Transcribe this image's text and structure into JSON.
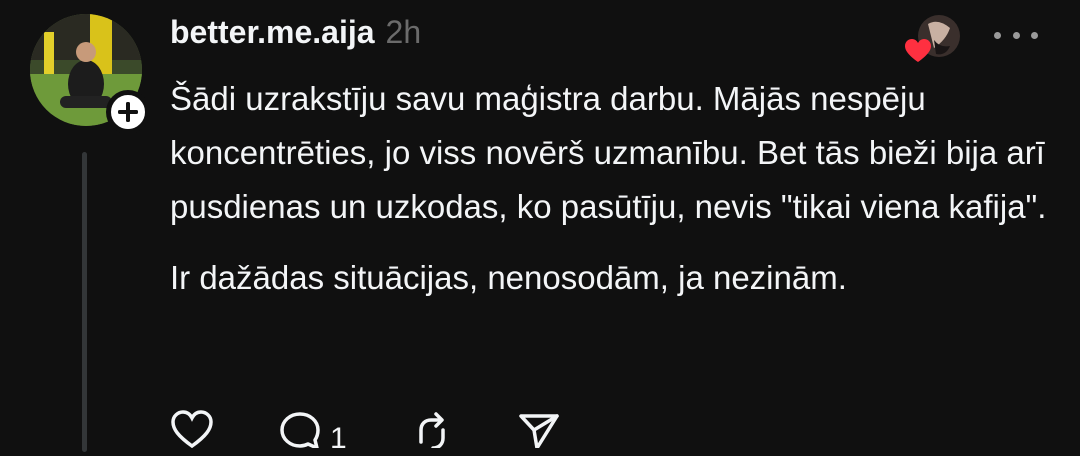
{
  "post": {
    "username": "better.me.aija",
    "time": "2h",
    "paragraphs": [
      "Šādi uzrakstīju savu maģistra darbu. Mājās nespēju koncentrēties, jo viss novērš uzmanību. Bet tās bieži bija arī pusdienas un uzkodas, ko pasūtīju, nevis \"tikai viena kafija\".",
      "Ir dažādas situācijas, nenosodām, ja nezinām."
    ],
    "actions": {
      "like_icon": "heart-outline-icon",
      "reply_icon": "comment-bubble-icon",
      "reply_count": "1",
      "repost_icon": "repost-icon",
      "share_icon": "send-icon"
    },
    "liked_by_icon": "heart-filled-icon",
    "more_icon": "more-horizontal-icon",
    "follow_icon": "plus-icon"
  },
  "colors": {
    "background": "#101010",
    "text": "#f3f5f7",
    "muted": "#6b6b6b",
    "heart": "#ff3040",
    "thread_line": "#333638"
  }
}
